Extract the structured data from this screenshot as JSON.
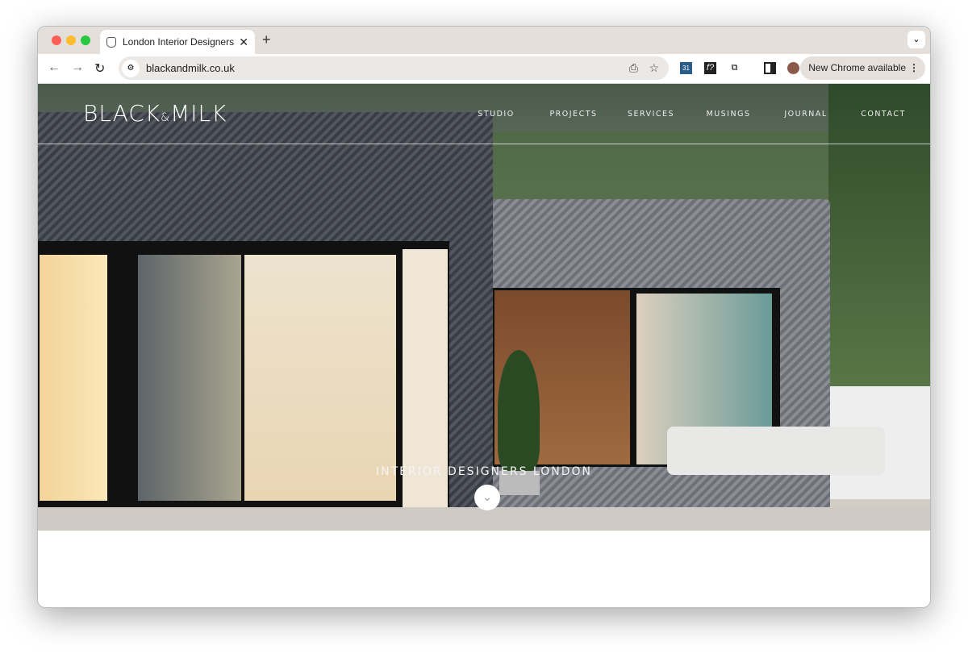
{
  "browser": {
    "tab_title": "London Interior Designers | Tu",
    "url": "blackandmilk.co.uk",
    "update_label": "New Chrome available",
    "icons": [
      "back-icon",
      "forward-icon",
      "reload-icon",
      "site-info-icon",
      "install-icon",
      "bookmark-star-icon",
      "calendar-extension-icon",
      "font-extension-icon",
      "extensions-puzzle-icon",
      "side-panel-icon",
      "profile-avatar",
      "more-menu-icon"
    ]
  },
  "site": {
    "logo_left": "BLACK",
    "logo_amp": "&",
    "logo_right": "MILK",
    "nav": [
      "STUDIO",
      "PROJECTS",
      "SERVICES",
      "MUSINGS",
      "JOURNAL",
      "CONTACT"
    ],
    "tagline": "INTERIOR DESIGNERS LONDON"
  }
}
